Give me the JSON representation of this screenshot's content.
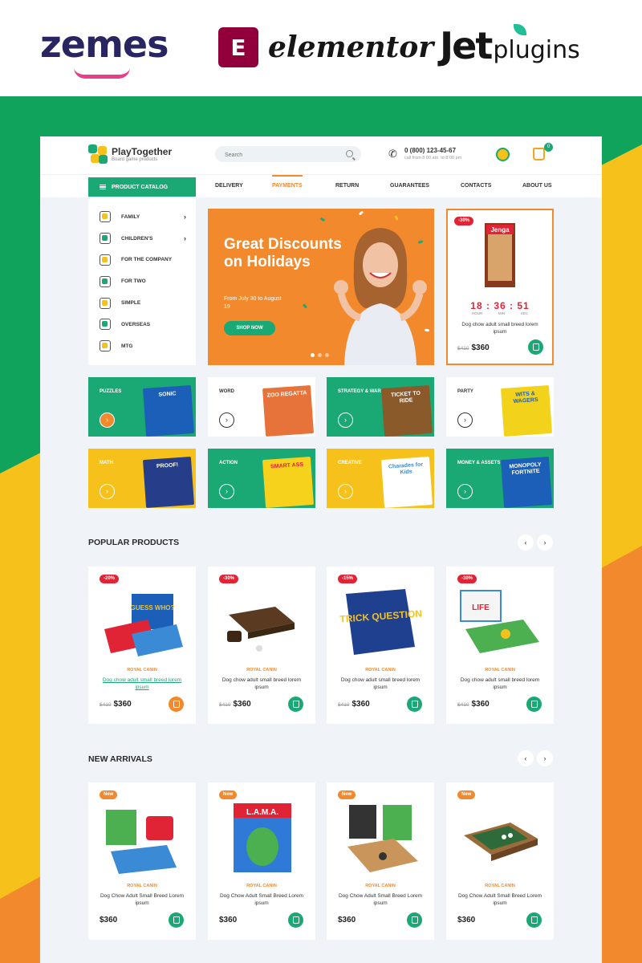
{
  "brands": {
    "zemes": "zemes",
    "elementor_logo": "E",
    "elementor": "elementor",
    "jet": "Jet",
    "plugins": "plugins"
  },
  "colors": {
    "green": "#1aa874",
    "orange": "#f2892c",
    "yellow": "#f7c11c",
    "red": "#e02436"
  },
  "header": {
    "logo_name": "PlayTogether",
    "logo_tagline": "Board game products",
    "search_placeholder": "Search",
    "phone": "0 (800) 123-45-67",
    "phone_hours": "call from 8:00 am. to 8:00 pm",
    "cart_count": "0"
  },
  "nav": {
    "catalog": "PRODUCT CATALOG",
    "links": [
      "DELIVERY",
      "PAYMENTS",
      "RETURN",
      "GUARANTEES",
      "CONTACTS",
      "ABOUT US"
    ],
    "active": "PAYMENTS"
  },
  "catalog": [
    {
      "label": "FAMILY",
      "icon": "family-icon"
    },
    {
      "label": "CHILDREN'S",
      "icon": "stroller-icon"
    },
    {
      "label": "FOR THE COMPANY",
      "icon": "group-icon"
    },
    {
      "label": "FOR TWO",
      "icon": "pair-icon"
    },
    {
      "label": "SIMPLE",
      "icon": "puzzle-icon"
    },
    {
      "label": "OVERSEAS",
      "icon": "globe-icon"
    },
    {
      "label": "MTG",
      "icon": "cards-icon"
    }
  ],
  "hero": {
    "title": "Great Discounts on Holidays",
    "subtitle": "From July 30 to August 19",
    "button": "SHOP NOW"
  },
  "deal": {
    "badge": "-30%",
    "box_text": "Jenga",
    "timer": {
      "hours": "18",
      "minutes": "36",
      "seconds": "51"
    },
    "timer_labels": [
      "HOUR",
      "MIN",
      "SEC"
    ],
    "name": "Dog chow adult small breed lorem ipsum",
    "old_price": "$410",
    "price": "$360"
  },
  "tiles": [
    {
      "label": "PUZZLES",
      "box": "SONIC"
    },
    {
      "label": "WORD",
      "box": "ZOO REGATTA"
    },
    {
      "label": "STRATEGY & WAR",
      "box": "TICKET TO RIDE"
    },
    {
      "label": "PARTY",
      "box": "WITS & WAGERS"
    },
    {
      "label": "MATH",
      "box": "PROOF!"
    },
    {
      "label": "ACTION",
      "box": "SMART ASS"
    },
    {
      "label": "CREATIVE",
      "box": "Charades for Kids"
    },
    {
      "label": "MONEY & ASSETS",
      "box": "MONOPOLY FORTNITE"
    }
  ],
  "popular": {
    "title": "POPULAR PRODUCTS",
    "items": [
      {
        "badge": "-20%",
        "box": "GUESS WHO?",
        "brand": "ROYAL CANIN",
        "name": "Dog chow adult small breed lorem ipsum",
        "old_price": "$410",
        "price": "$360"
      },
      {
        "badge": "-30%",
        "box": "",
        "brand": "ROYAL CANIN",
        "name": "Dog chow adult small breed lorem ipsum",
        "old_price": "$410",
        "price": "$360"
      },
      {
        "badge": "-15%",
        "box": "TRICK QUESTION",
        "brand": "ROYAL CANIN",
        "name": "Dog chow adult small breed lorem ipsum",
        "old_price": "$410",
        "price": "$360"
      },
      {
        "badge": "-30%",
        "box": "LIFE",
        "brand": "ROYAL CANIN",
        "name": "Dog chow adult small breed lorem ipsum",
        "old_price": "$410",
        "price": "$360"
      }
    ]
  },
  "arrivals": {
    "title": "NEW ARRIVALS",
    "items": [
      {
        "badge": "New",
        "box": "",
        "brand": "ROYAL CANIN",
        "name": "Dog Chow Adult Small Breed Lorem ipsum",
        "price": "$360"
      },
      {
        "badge": "New",
        "box": "L.A.M.A.",
        "brand": "ROYAL CANIN",
        "name": "Dog Chow Adult Small Breed Lorem ipsum",
        "price": "$360"
      },
      {
        "badge": "New",
        "box": "",
        "brand": "ROYAL CANIN",
        "name": "Dog Chow Adult Small Breed Lorem ipsum",
        "price": "$360"
      },
      {
        "badge": "New",
        "box": "",
        "brand": "ROYAL CANIN",
        "name": "Dog Chow Adult Small Breed Lorem ipsum",
        "price": "$360"
      }
    ]
  }
}
